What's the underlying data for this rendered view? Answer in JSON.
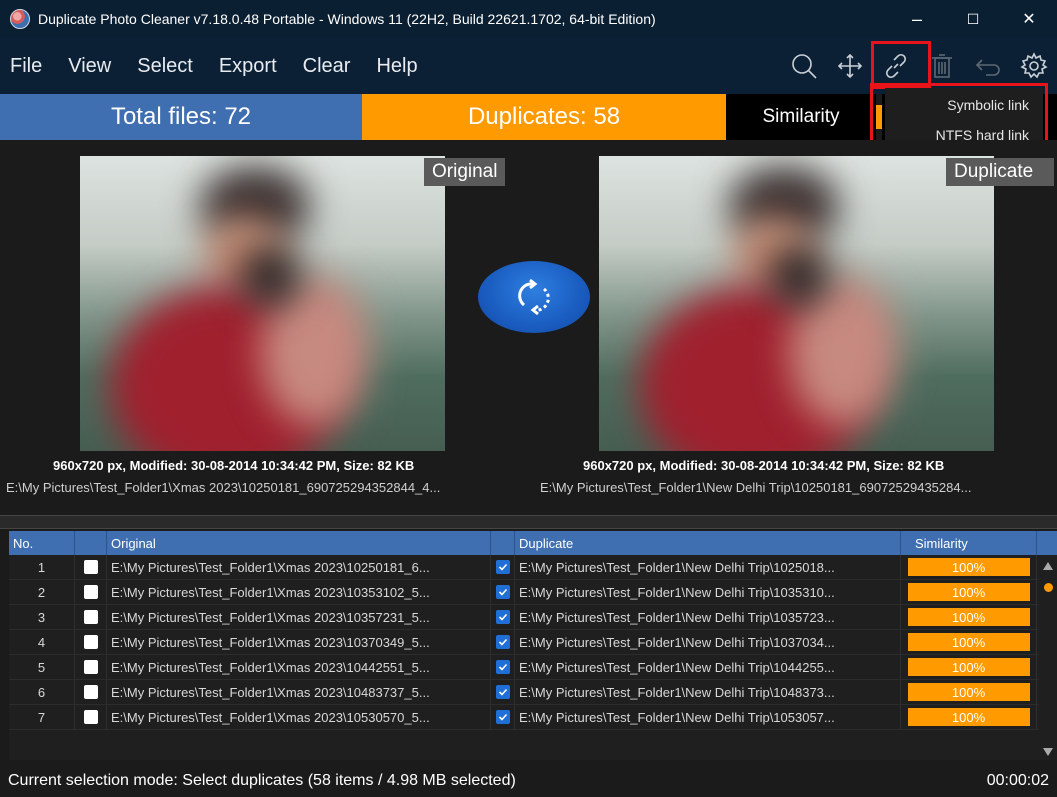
{
  "window": {
    "title": "Duplicate Photo Cleaner v7.18.0.48 Portable - Windows 11 (22H2, Build 22621.1702, 64-bit Edition)",
    "minimize": "–",
    "maximize": "☐",
    "close": "✕"
  },
  "menu": {
    "items": [
      {
        "label": "File"
      },
      {
        "label": "View"
      },
      {
        "label": "Select"
      },
      {
        "label": "Export"
      },
      {
        "label": "Clear"
      },
      {
        "label": "Help"
      }
    ],
    "tools": [
      "search-icon",
      "move-icon",
      "link-icon",
      "trash-icon",
      "undo-icon",
      "settings-icon"
    ]
  },
  "summary": {
    "total": "Total files: 72",
    "duplicates": "Duplicates: 58",
    "similarity": "Similarity"
  },
  "link_menu": {
    "items": [
      {
        "label": "Symbolic link"
      },
      {
        "label": "NTFS hard link"
      }
    ]
  },
  "preview": {
    "original_tag": "Original",
    "duplicate_tag": "Duplicate",
    "original_caption": "960x720 px, Modified: 30-08-2014 10:34:42 PM, Size: 82 KB",
    "duplicate_caption": "960x720 px, Modified: 30-08-2014 10:34:42 PM, Size: 82 KB",
    "original_path": "E:\\My Pictures\\Test_Folder1\\Xmas 2023\\10250181_690725294352844_4...",
    "duplicate_path": "E:\\My Pictures\\Test_Folder1\\New Delhi Trip\\10250181_69072529435284..."
  },
  "table": {
    "headers": {
      "no": "No.",
      "original": "Original",
      "duplicate": "Duplicate",
      "similarity": "Similarity"
    },
    "rows": [
      {
        "no": "1",
        "original": "E:\\My Pictures\\Test_Folder1\\Xmas 2023\\10250181_6...",
        "duplicate": "E:\\My Pictures\\Test_Folder1\\New Delhi Trip\\1025018...",
        "similarity": "100%"
      },
      {
        "no": "2",
        "original": "E:\\My Pictures\\Test_Folder1\\Xmas 2023\\10353102_5...",
        "duplicate": "E:\\My Pictures\\Test_Folder1\\New Delhi Trip\\1035310...",
        "similarity": "100%"
      },
      {
        "no": "3",
        "original": "E:\\My Pictures\\Test_Folder1\\Xmas 2023\\10357231_5...",
        "duplicate": "E:\\My Pictures\\Test_Folder1\\New Delhi Trip\\1035723...",
        "similarity": "100%"
      },
      {
        "no": "4",
        "original": "E:\\My Pictures\\Test_Folder1\\Xmas 2023\\10370349_5...",
        "duplicate": "E:\\My Pictures\\Test_Folder1\\New Delhi Trip\\1037034...",
        "similarity": "100%"
      },
      {
        "no": "5",
        "original": "E:\\My Pictures\\Test_Folder1\\Xmas 2023\\10442551_5...",
        "duplicate": "E:\\My Pictures\\Test_Folder1\\New Delhi Trip\\1044255...",
        "similarity": "100%"
      },
      {
        "no": "6",
        "original": "E:\\My Pictures\\Test_Folder1\\Xmas 2023\\10483737_5...",
        "duplicate": "E:\\My Pictures\\Test_Folder1\\New Delhi Trip\\1048373...",
        "similarity": "100%"
      },
      {
        "no": "7",
        "original": "E:\\My Pictures\\Test_Folder1\\Xmas 2023\\10530570_5...",
        "duplicate": "E:\\My Pictures\\Test_Folder1\\New Delhi Trip\\1053057...",
        "similarity": "100%"
      }
    ]
  },
  "status": {
    "mode": "Current selection mode: Select duplicates (58 items / 4.98 MB selected)",
    "timer": "00:00:02"
  },
  "colors": {
    "accent_blue": "#3f6fb1",
    "accent_orange": "#ff9a00",
    "highlight_red": "#e8141a"
  }
}
